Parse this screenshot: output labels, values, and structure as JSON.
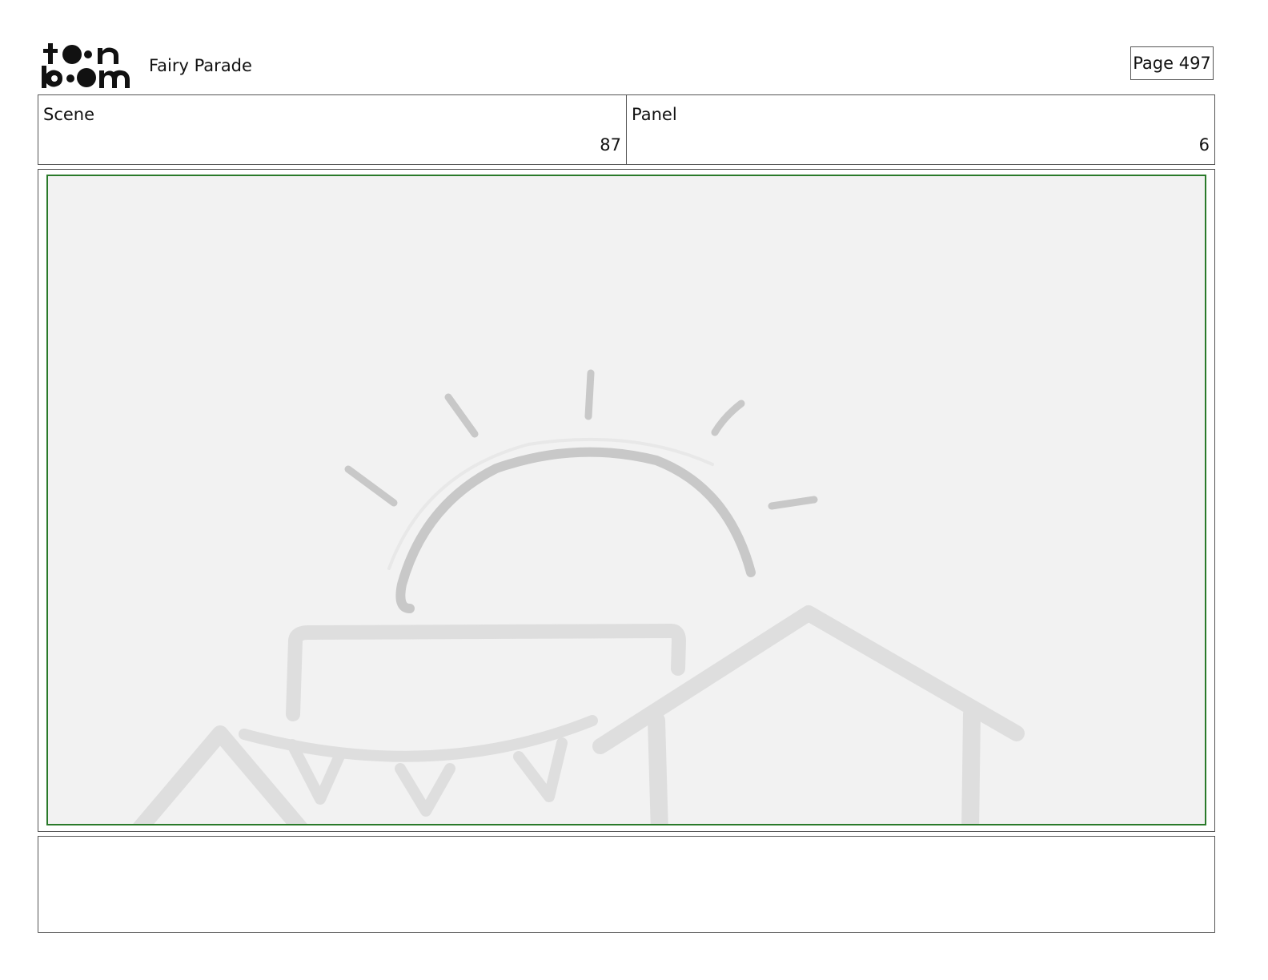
{
  "header": {
    "logo_line1": "toon",
    "logo_line2": "boom",
    "project_title": "Fairy Parade",
    "page_label": "Page 497"
  },
  "info": {
    "scene_label": "Scene",
    "scene_value": "87",
    "panel_label": "Panel",
    "panel_value": "6"
  },
  "panel": {
    "frame_color": "#2a7a2a",
    "background_color": "#f2f2f2",
    "sketch": [
      "sun-icon",
      "sun-rays-icon",
      "tent-roof-icon",
      "bunting-icon",
      "house-roof-icon"
    ]
  },
  "notes": {
    "text": ""
  }
}
